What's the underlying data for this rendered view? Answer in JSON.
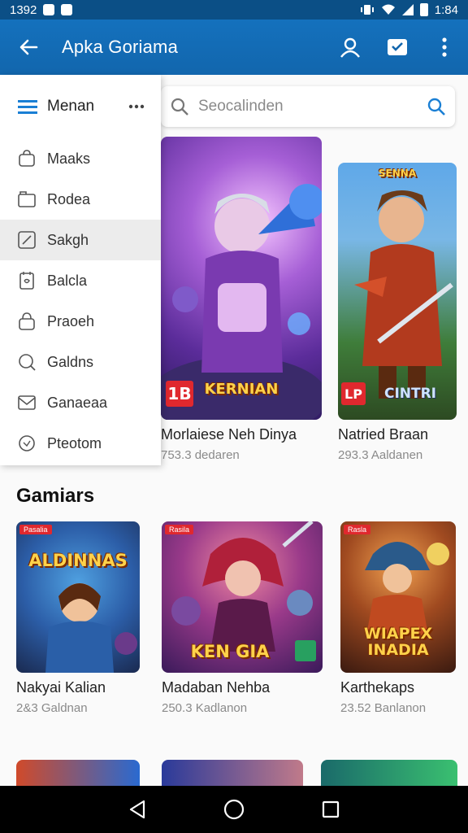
{
  "status": {
    "time_left": "1392",
    "time_right": "1:84"
  },
  "appbar": {
    "title": "Apka Goriama"
  },
  "search": {
    "placeholder": "Seocalinden"
  },
  "drawer": {
    "header_label": "Menan",
    "items": [
      {
        "label": "Maaks",
        "icon": "bag-icon"
      },
      {
        "label": "Rodea",
        "icon": "folder-icon"
      },
      {
        "label": "Sakgh",
        "icon": "edit-icon"
      },
      {
        "label": "Balcla",
        "icon": "document-icon"
      },
      {
        "label": "Praoeh",
        "icon": "lock-icon"
      },
      {
        "label": "Galdns",
        "icon": "search-icon"
      },
      {
        "label": "Ganaeaa",
        "icon": "mail-icon"
      },
      {
        "label": "Pteotom",
        "icon": "shield-icon"
      }
    ]
  },
  "featured": [
    {
      "name": "Morlaiese Neh Dinya",
      "sub": "753.3 dedaren",
      "art_title": "KERNIAN",
      "badge": "1B"
    },
    {
      "name": "Natried Braan",
      "sub": "293.3 Aaldanen",
      "art_title": "CINTRI",
      "badge": "LP"
    }
  ],
  "section": {
    "title": "Gamiars"
  },
  "games": [
    {
      "name": "Nakyai Kalian",
      "sub": "2&3 Galdnan",
      "art_title": "ALDINNAS",
      "tag": "Pasalia"
    },
    {
      "name": "Madaban Nehba",
      "sub": "250.3 Kadlanon",
      "art_title": "KEN GIA",
      "tag": "Rasila"
    },
    {
      "name": "Karthekaps",
      "sub": "23.52 Banlanon",
      "art_title": "WIAPEX INADIA",
      "tag": "Rasla"
    }
  ],
  "colors": {
    "primary": "#1266ad",
    "statusbar": "#0b4f86",
    "accent": "#1a7fd4"
  }
}
